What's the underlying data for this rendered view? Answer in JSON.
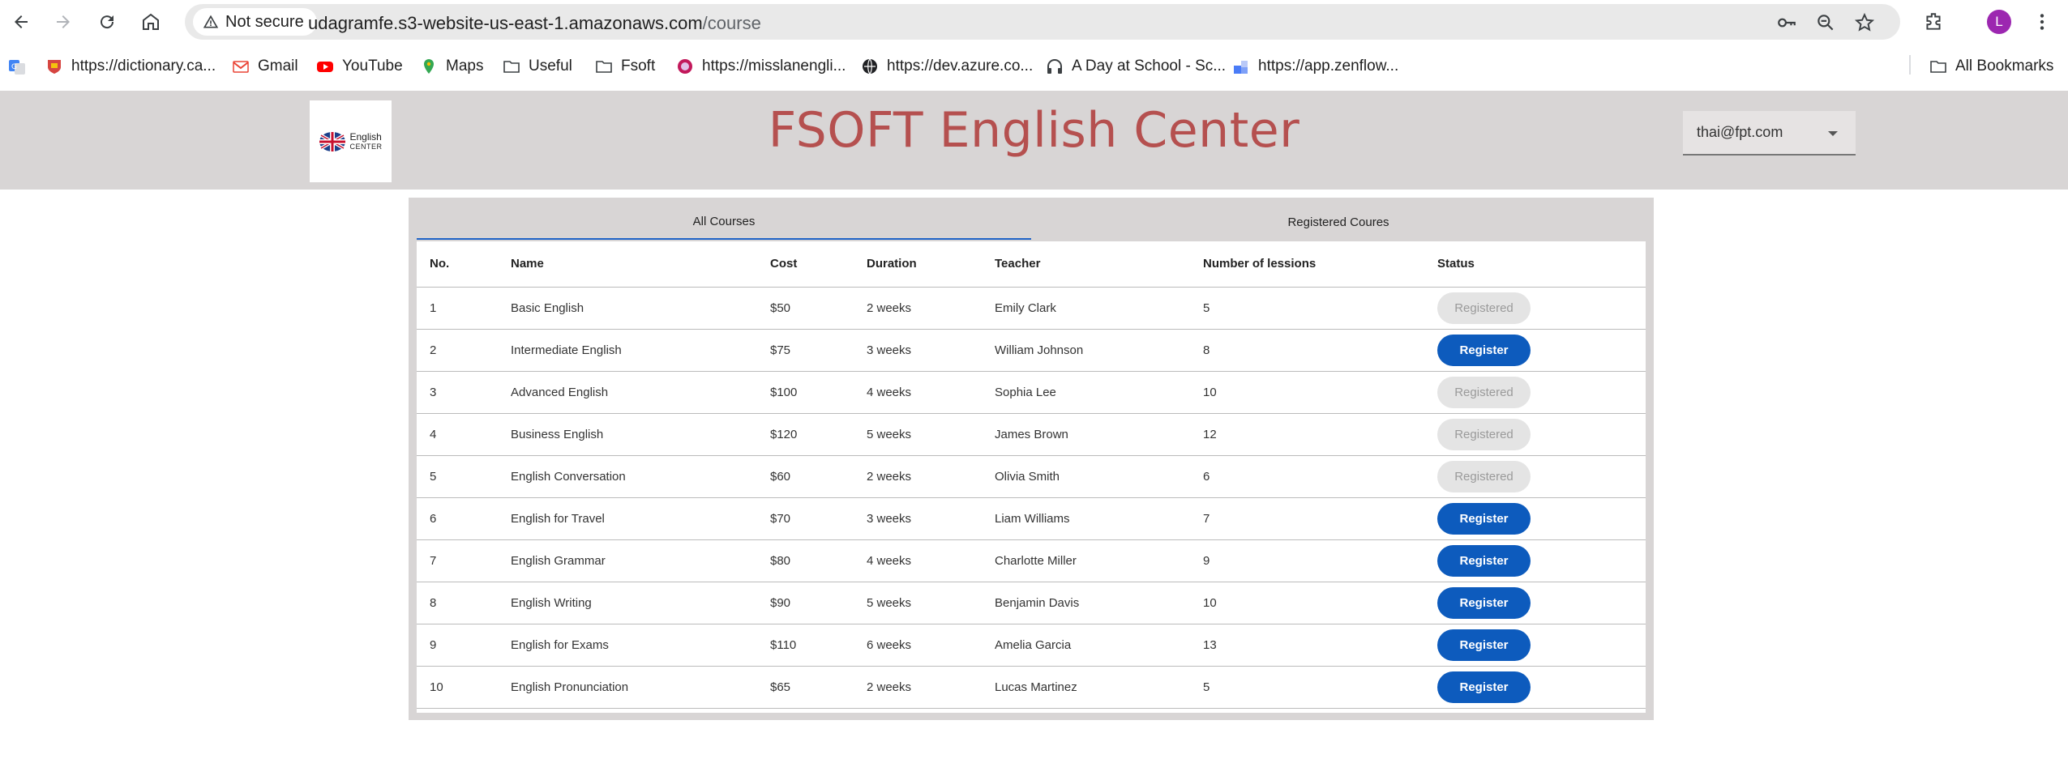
{
  "browser": {
    "security_label": "Not secure",
    "url_host": "udagramfe.s3-website-us-east-1.amazonaws.com",
    "url_path": "/course",
    "avatar_letter": "L"
  },
  "bookmarks": {
    "items": [
      {
        "label": "",
        "icon": "translate-icon"
      },
      {
        "label": "https://dictionary.ca...",
        "icon": "cambridge-icon"
      },
      {
        "label": "Gmail",
        "icon": "gmail-icon"
      },
      {
        "label": "YouTube",
        "icon": "youtube-icon"
      },
      {
        "label": "Maps",
        "icon": "maps-icon"
      },
      {
        "label": "Useful",
        "icon": "folder-icon"
      },
      {
        "label": "Fsoft",
        "icon": "folder-icon"
      },
      {
        "label": "https://misslanengli...",
        "icon": "site-icon"
      },
      {
        "label": "https://dev.azure.co...",
        "icon": "globe-icon"
      },
      {
        "label": "A Day at School - Sc...",
        "icon": "headphones-icon"
      },
      {
        "label": "https://app.zenflow...",
        "icon": "zenflow-icon"
      }
    ],
    "all_label": "All Bookmarks"
  },
  "header": {
    "logo_line1": "English",
    "logo_line2": "CENTER",
    "title": "FSOFT English Center",
    "user_email": "thai@fpt.com"
  },
  "tabs": [
    {
      "label": "All Courses",
      "active": true
    },
    {
      "label": "Registered Coures",
      "active": false
    }
  ],
  "table": {
    "columns": [
      "No.",
      "Name",
      "Cost",
      "Duration",
      "Teacher",
      "Number of lessions",
      "Status"
    ],
    "rows": [
      {
        "no": "1",
        "name": "Basic English",
        "cost": "$50",
        "duration": "2 weeks",
        "teacher": "Emily Clark",
        "lessons": "5",
        "status": "Registered"
      },
      {
        "no": "2",
        "name": "Intermediate English",
        "cost": "$75",
        "duration": "3 weeks",
        "teacher": "William Johnson",
        "lessons": "8",
        "status": "Register"
      },
      {
        "no": "3",
        "name": "Advanced English",
        "cost": "$100",
        "duration": "4 weeks",
        "teacher": "Sophia Lee",
        "lessons": "10",
        "status": "Registered"
      },
      {
        "no": "4",
        "name": "Business English",
        "cost": "$120",
        "duration": "5 weeks",
        "teacher": "James Brown",
        "lessons": "12",
        "status": "Registered"
      },
      {
        "no": "5",
        "name": "English Conversation",
        "cost": "$60",
        "duration": "2 weeks",
        "teacher": "Olivia Smith",
        "lessons": "6",
        "status": "Registered"
      },
      {
        "no": "6",
        "name": "English for Travel",
        "cost": "$70",
        "duration": "3 weeks",
        "teacher": "Liam Williams",
        "lessons": "7",
        "status": "Register"
      },
      {
        "no": "7",
        "name": "English Grammar",
        "cost": "$80",
        "duration": "4 weeks",
        "teacher": "Charlotte Miller",
        "lessons": "9",
        "status": "Register"
      },
      {
        "no": "8",
        "name": "English Writing",
        "cost": "$90",
        "duration": "5 weeks",
        "teacher": "Benjamin Davis",
        "lessons": "10",
        "status": "Register"
      },
      {
        "no": "9",
        "name": "English for Exams",
        "cost": "$110",
        "duration": "6 weeks",
        "teacher": "Amelia Garcia",
        "lessons": "13",
        "status": "Register"
      },
      {
        "no": "10",
        "name": "English Pronunciation",
        "cost": "$65",
        "duration": "2 weeks",
        "teacher": "Lucas Martinez",
        "lessons": "5",
        "status": "Register"
      }
    ]
  },
  "colors": {
    "title": "#b5504f",
    "header_bg": "#d8d5d5",
    "register_button": "#0d5bbd",
    "registered_button": "#e4e4e4",
    "tab_indicator": "#1f63c6"
  }
}
